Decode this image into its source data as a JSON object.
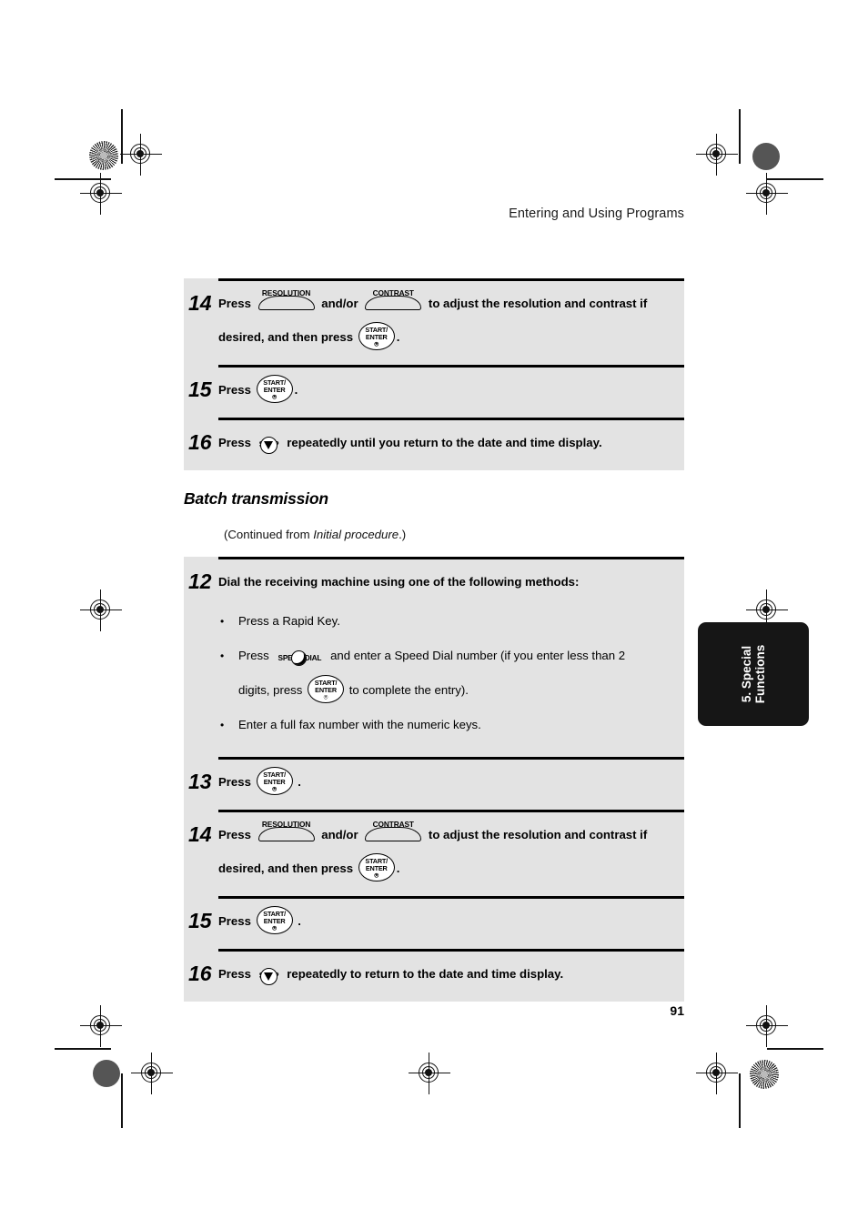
{
  "header": {
    "title": "Entering and Using Programs"
  },
  "page_number": "91",
  "side_tab": {
    "line1": "5. Special",
    "line2": "Functions"
  },
  "keys": {
    "resolution": "RESOLUTION",
    "contrast": "CONTRAST",
    "start_enter_line1": "START/",
    "start_enter_line2": "ENTER",
    "start_enter_glyph": "⍟",
    "stop": "STOP",
    "speed_dial": "SPEED DIAL"
  },
  "top_section": {
    "steps": [
      {
        "number": "14",
        "text_a": "Press",
        "text_b": "and/or",
        "text_c": "to adjust the resolution and contrast if",
        "text_d": "desired, and then press",
        "text_e": "."
      },
      {
        "number": "15",
        "text_a": "Press",
        "text_b": "."
      },
      {
        "number": "16",
        "text_a": "Press",
        "text_b": "repeatedly until you return to the date and time display."
      }
    ]
  },
  "section": {
    "heading": "Batch transmission",
    "continued_prefix": "(Continued from ",
    "continued_italic": "Initial procedure",
    "continued_suffix": ".)"
  },
  "bottom_section": {
    "steps": [
      {
        "number": "12",
        "title": "Dial the receiving machine using one of the following methods:",
        "bullets": {
          "b1": "Press a Rapid Key.",
          "b2_a": "Press",
          "b2_b": "and enter a Speed Dial number (if you enter less than 2",
          "b2_c": "digits, press",
          "b2_d": "to complete the entry).",
          "b3": "Enter a full fax number with the numeric keys."
        }
      },
      {
        "number": "13",
        "text_a": "Press",
        "text_b": "."
      },
      {
        "number": "14",
        "text_a": "Press",
        "text_b": "and/or",
        "text_c": "to adjust the resolution and contrast if",
        "text_d": "desired, and then press",
        "text_e": "."
      },
      {
        "number": "15",
        "text_a": "Press",
        "text_b": "."
      },
      {
        "number": "16",
        "text_a": "Press",
        "text_b": "repeatedly to return to the date and time display."
      }
    ]
  }
}
